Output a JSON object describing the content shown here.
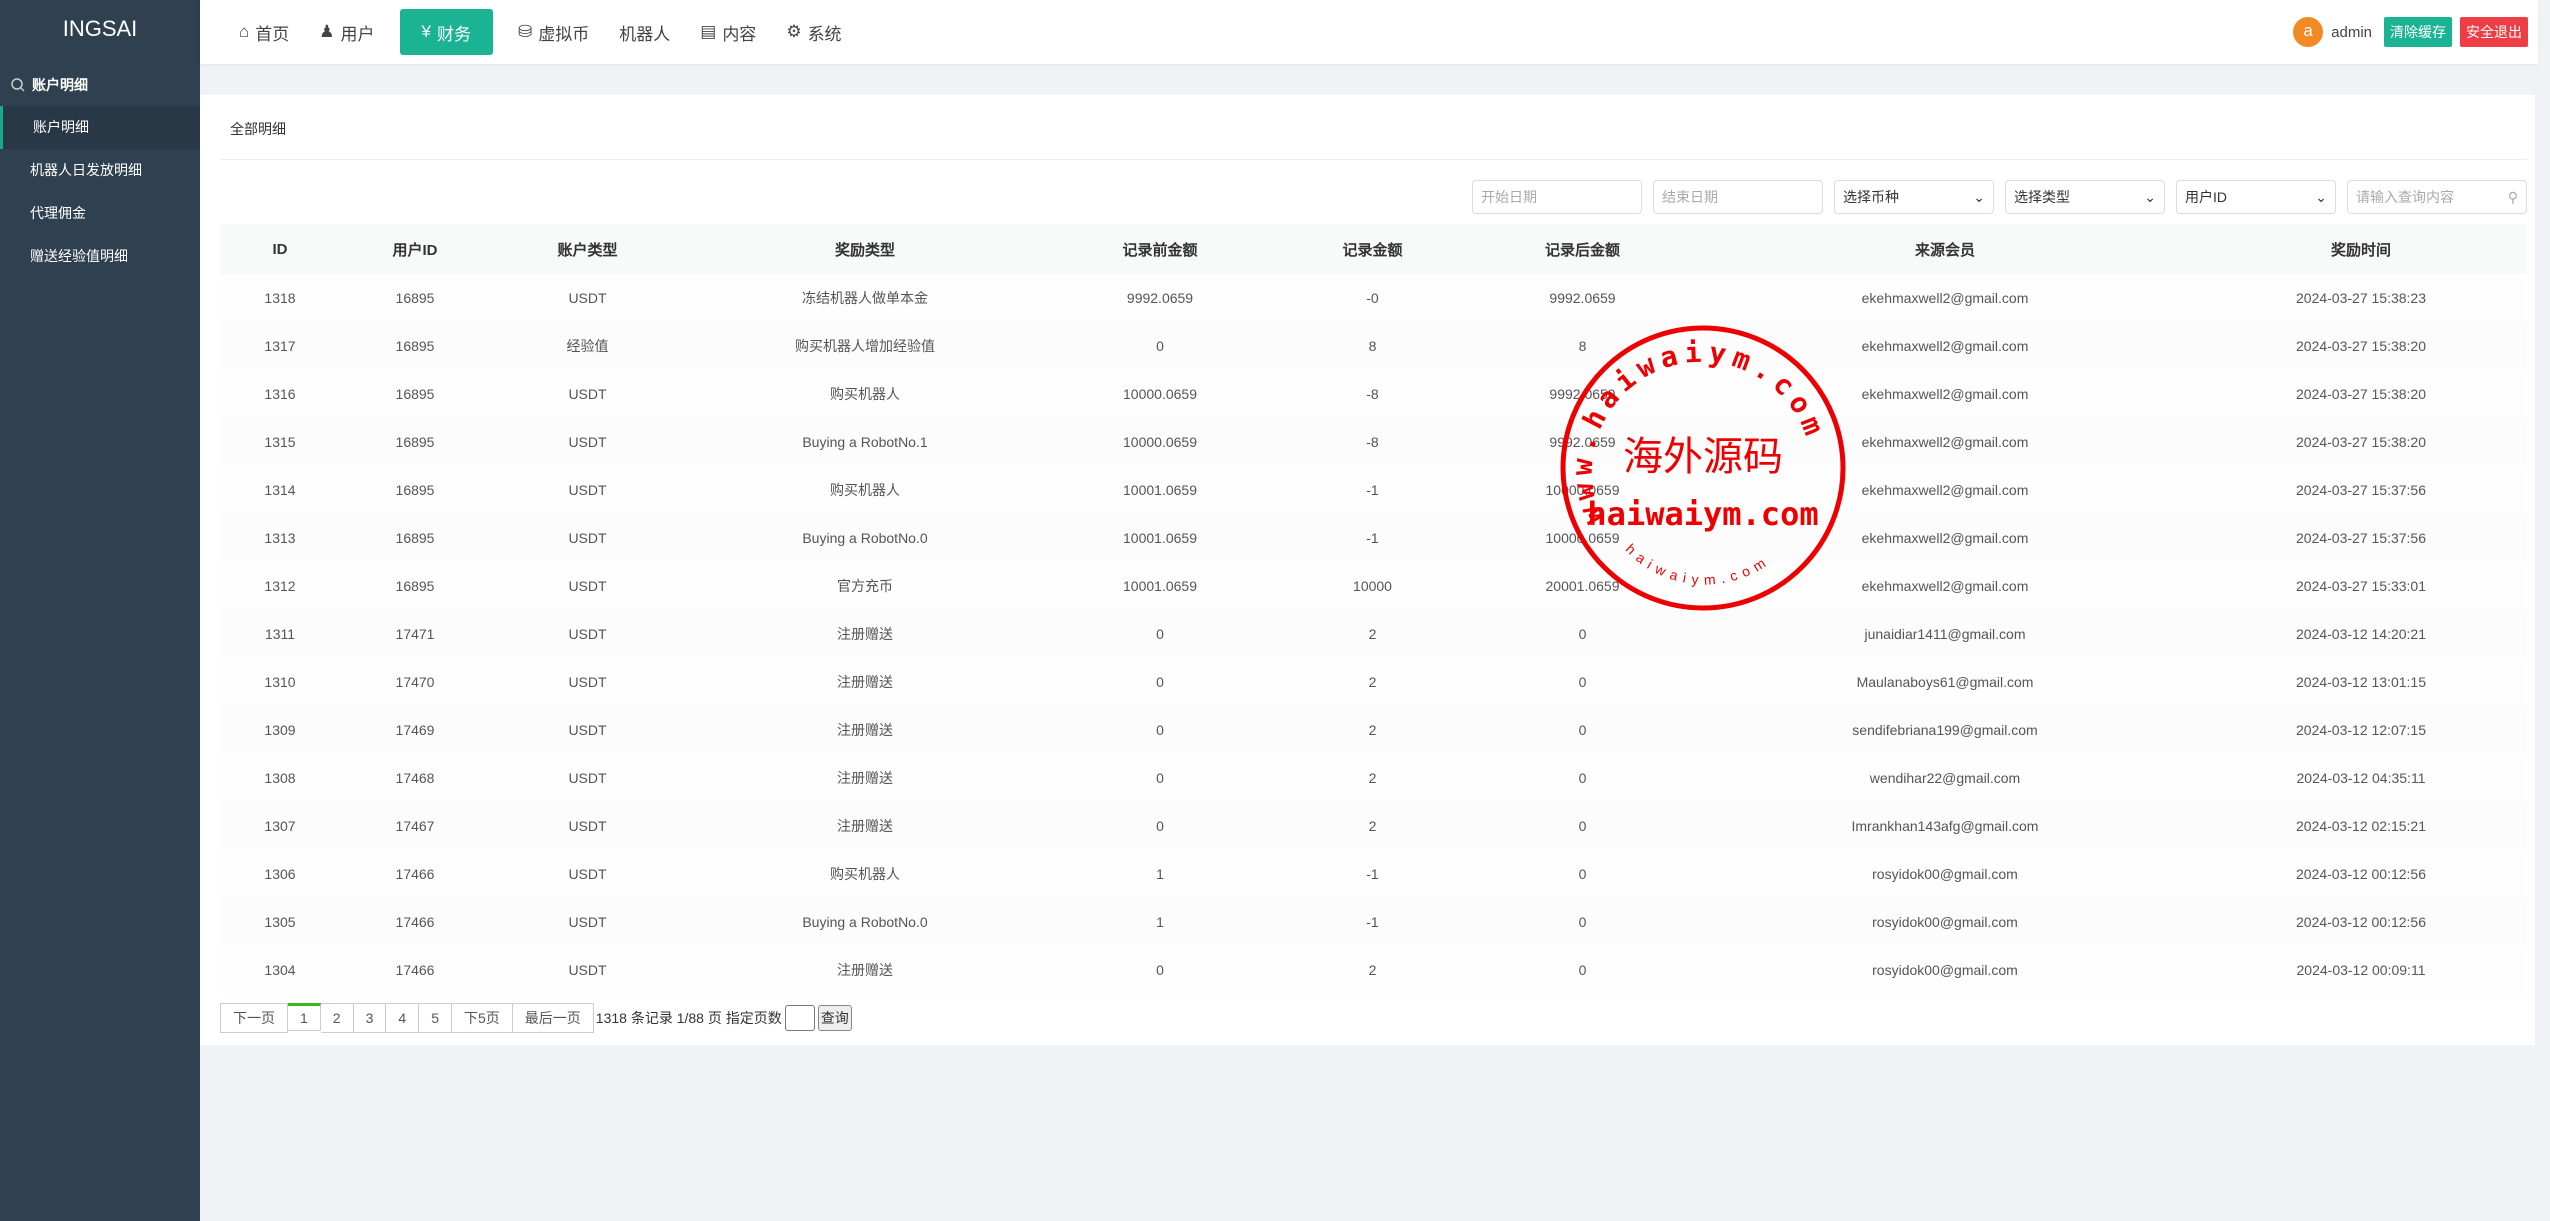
{
  "app": {
    "logo": "INGSAI"
  },
  "sidebar": {
    "section": "账户明细",
    "items": [
      {
        "label": "账户明细",
        "active": true
      },
      {
        "label": "机器人日发放明细"
      },
      {
        "label": "代理佣金"
      },
      {
        "label": "赠送经验值明细"
      }
    ]
  },
  "nav": {
    "items": [
      {
        "label": "首页",
        "icon": "home-icon"
      },
      {
        "label": "用户",
        "icon": "user-icon"
      },
      {
        "label": "财务",
        "icon": "money-icon",
        "active": true
      },
      {
        "label": "虚拟币",
        "icon": "database-icon"
      },
      {
        "label": "机器人"
      },
      {
        "label": "内容",
        "icon": "list-icon"
      },
      {
        "label": "系统",
        "icon": "gear-icon"
      }
    ]
  },
  "user": {
    "avatar": "a",
    "name": "admin",
    "clear_cache": "清除缓存",
    "logout": "安全退出"
  },
  "colors": {
    "accent": "#1ab394",
    "danger": "#ed3e45",
    "sidebar": "#2f4050",
    "avatar": "#f18a24"
  },
  "page": {
    "title": "全部明细"
  },
  "filters": {
    "start_date": "开始日期",
    "end_date": "结束日期",
    "currency": "选择币种",
    "type": "选择类型",
    "field": "用户ID",
    "search": "请输入查询内容"
  },
  "table": {
    "headers": [
      "ID",
      "用户ID",
      "账户类型",
      "奖励类型",
      "记录前金额",
      "记录金额",
      "记录后金额",
      "来源会员",
      "奖励时间"
    ],
    "rows": [
      [
        "1318",
        "16895",
        "USDT",
        "冻结机器人做单本金",
        "9992.0659",
        "-0",
        "9992.0659",
        "ekehmaxwell2@gmail.com",
        "2024-03-27 15:38:23"
      ],
      [
        "1317",
        "16895",
        "经验值",
        "购买机器人增加经验值",
        "0",
        "8",
        "8",
        "ekehmaxwell2@gmail.com",
        "2024-03-27 15:38:20"
      ],
      [
        "1316",
        "16895",
        "USDT",
        "购买机器人",
        "10000.0659",
        "-8",
        "9992.0659",
        "ekehmaxwell2@gmail.com",
        "2024-03-27 15:38:20"
      ],
      [
        "1315",
        "16895",
        "USDT",
        "Buying a RobotNo.1",
        "10000.0659",
        "-8",
        "9992.0659",
        "ekehmaxwell2@gmail.com",
        "2024-03-27 15:38:20"
      ],
      [
        "1314",
        "16895",
        "USDT",
        "购买机器人",
        "10001.0659",
        "-1",
        "10000.0659",
        "ekehmaxwell2@gmail.com",
        "2024-03-27 15:37:56"
      ],
      [
        "1313",
        "16895",
        "USDT",
        "Buying a RobotNo.0",
        "10001.0659",
        "-1",
        "10000.0659",
        "ekehmaxwell2@gmail.com",
        "2024-03-27 15:37:56"
      ],
      [
        "1312",
        "16895",
        "USDT",
        "官方充币",
        "10001.0659",
        "10000",
        "20001.0659",
        "ekehmaxwell2@gmail.com",
        "2024-03-27 15:33:01"
      ],
      [
        "1311",
        "17471",
        "USDT",
        "注册赠送",
        "0",
        "2",
        "0",
        "junaidiar1411@gmail.com",
        "2024-03-12 14:20:21"
      ],
      [
        "1310",
        "17470",
        "USDT",
        "注册赠送",
        "0",
        "2",
        "0",
        "Maulanaboys61@gmail.com",
        "2024-03-12 13:01:15"
      ],
      [
        "1309",
        "17469",
        "USDT",
        "注册赠送",
        "0",
        "2",
        "0",
        "sendifebriana199@gmail.com",
        "2024-03-12 12:07:15"
      ],
      [
        "1308",
        "17468",
        "USDT",
        "注册赠送",
        "0",
        "2",
        "0",
        "wendihar22@gmail.com",
        "2024-03-12 04:35:11"
      ],
      [
        "1307",
        "17467",
        "USDT",
        "注册赠送",
        "0",
        "2",
        "0",
        "Imrankhan143afg@gmail.com",
        "2024-03-12 02:15:21"
      ],
      [
        "1306",
        "17466",
        "USDT",
        "购买机器人",
        "1",
        "-1",
        "0",
        "rosyidok00@gmail.com",
        "2024-03-12 00:12:56"
      ],
      [
        "1305",
        "17466",
        "USDT",
        "Buying a RobotNo.0",
        "1",
        "-1",
        "0",
        "rosyidok00@gmail.com",
        "2024-03-12 00:12:56"
      ],
      [
        "1304",
        "17466",
        "USDT",
        "注册赠送",
        "0",
        "2",
        "0",
        "rosyidok00@gmail.com",
        "2024-03-12 00:09:11"
      ]
    ]
  },
  "pager": {
    "prev": "下一页",
    "pages": [
      "1",
      "2",
      "3",
      "4",
      "5"
    ],
    "current": "1",
    "next5": "下5页",
    "last": "最后一页",
    "info": "1318 条记录 1/88 页 指定页数",
    "go": "查询"
  },
  "watermark": {
    "top": "www.haiwaiym.com",
    "center": "海外源码",
    "domain": "haiwaiym.com",
    "bottom": "haiwaiym.com"
  }
}
